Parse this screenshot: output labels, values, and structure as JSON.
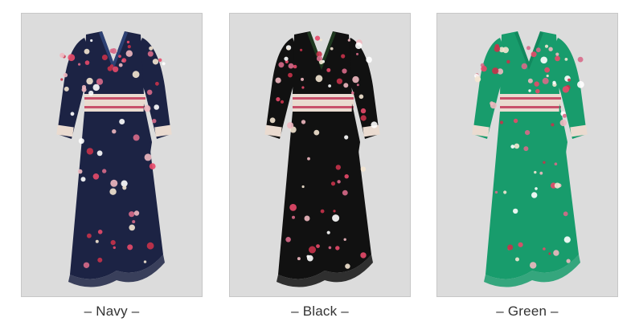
{
  "products": [
    {
      "label": "– Navy –",
      "color_name": "Navy",
      "dress_color": "#1c2344",
      "accent": "#3a5a9a"
    },
    {
      "label": "– Black –",
      "color_name": "Black",
      "dress_color": "#111111",
      "accent": "#2c5a2c"
    },
    {
      "label": "– Green –",
      "color_name": "Green",
      "dress_color": "#189c6c",
      "accent": "#0f7a53"
    }
  ],
  "card_background": "#dcdcdc"
}
